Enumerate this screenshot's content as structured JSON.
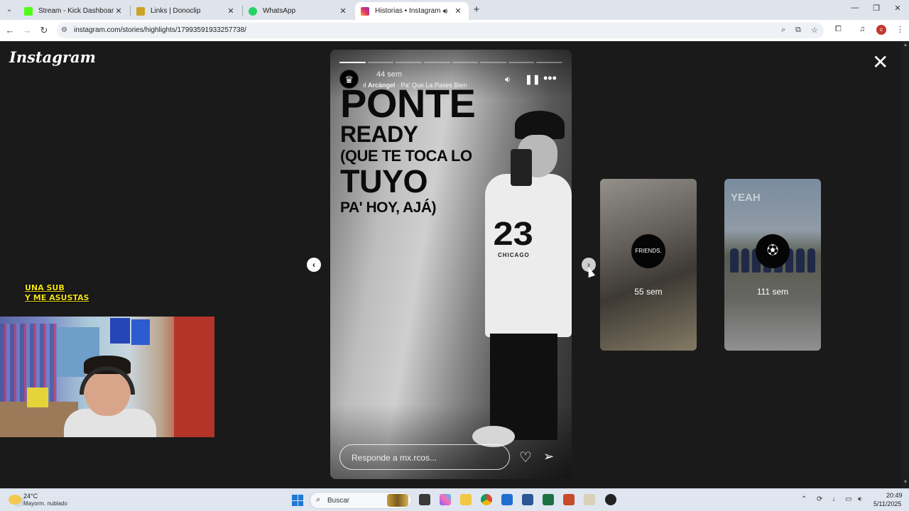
{
  "browser": {
    "tabs": [
      {
        "title": "Stream - Kick Dashboard",
        "favicon": "kick-icon",
        "color": "#53fc18"
      },
      {
        "title": "Links | Donoclip",
        "favicon": "donoclip-icon",
        "color": "#c9a227"
      },
      {
        "title": "WhatsApp",
        "favicon": "whatsapp-icon",
        "color": "#25d366"
      },
      {
        "title": "Historias • Instagram",
        "favicon": "instagram-icon",
        "color": "#e1306c"
      }
    ],
    "url": "instagram.com/stories/highlights/17993591933257738/",
    "profile_initial": "c"
  },
  "instagram": {
    "logo": "Instagram",
    "story": {
      "time_ago": "44 sem",
      "song_artist": "Arcángel",
      "song_title": "· Pa' Que La Pases Bien",
      "progress_segments": 8,
      "progress_active": 1,
      "headline": {
        "line1": "PONTE",
        "line2": "READY",
        "line3": "(QUE TE TOCA LO",
        "line4": "TUYO",
        "line5": "PA' HOY, AJÁ)"
      },
      "jersey_number": "23",
      "jersey_text": "CHICAGO",
      "reply_placeholder": "Responde a mx.rcos..."
    },
    "next_highlights": [
      {
        "time_ago": "55 sem",
        "label": "FRIENDS."
      },
      {
        "time_ago": "111 sem",
        "overlay_text": "YEAH"
      }
    ]
  },
  "stream_overlay": {
    "line1": "UNA SUB",
    "line2": "Y ME ASUSTAS"
  },
  "taskbar": {
    "weather_temp": "24°C",
    "weather_desc": "Mayorm. nublado",
    "search_placeholder": "Buscar",
    "time": "20:49",
    "date": "5/11/2025"
  }
}
